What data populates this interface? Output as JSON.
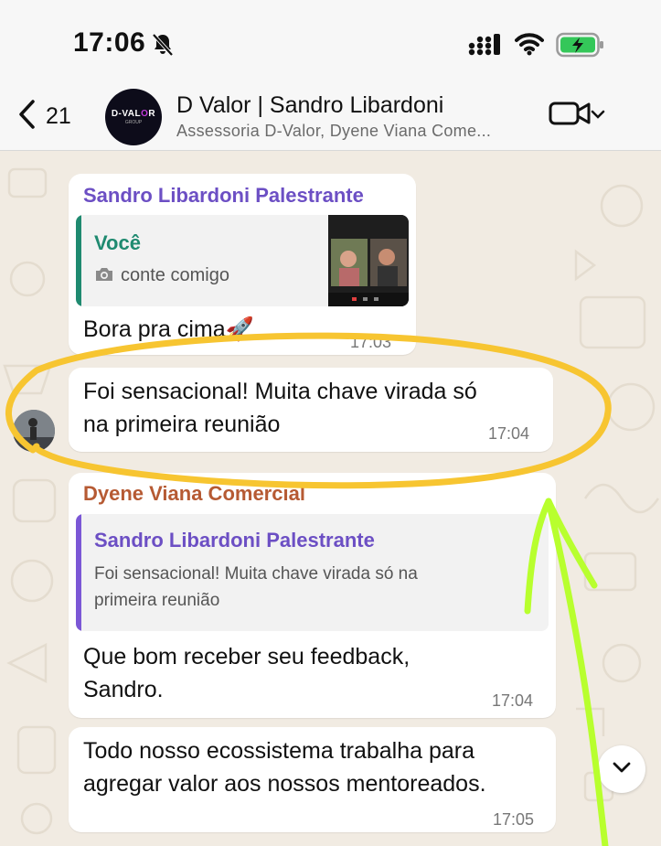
{
  "status_bar": {
    "time": "17:06",
    "icons": [
      "bell-slash-icon",
      "signal-icon",
      "wifi-icon",
      "battery-charging-icon"
    ]
  },
  "header": {
    "back_count": "21",
    "avatar_logo": "D-VAL",
    "avatar_logo_accent": "O",
    "avatar_logo_end": "R",
    "avatar_sub": "GROUP",
    "title": "D Valor | Sandro Libardoni",
    "subtitle": "Assessoria D-Valor, Dyene Viana Come..."
  },
  "messages": [
    {
      "sender": "Sandro Libardoni Palestrante",
      "quote_author": "Você",
      "quote_media_label": "conte comigo",
      "text": "Bora pra cima🚀",
      "time": "17:03"
    },
    {
      "text_line1": "Foi sensacional! Muita chave virada só",
      "text_line2": "na primeira reunião",
      "time": "17:04"
    },
    {
      "sender": "Dyene Viana Comercial",
      "quote_author": "Sandro Libardoni Palestrante",
      "quote_line1": "Foi sensacional! Muita chave virada só na",
      "quote_line2": "primeira reunião",
      "text_line1": "Que bom receber seu feedback,",
      "text_line2": "Sandro.",
      "time": "17:04"
    },
    {
      "text_line1": "Todo nosso ecossistema trabalha para",
      "text_line2": "agregar valor aos nossos mentoreados.",
      "time": "17:05"
    }
  ],
  "colors": {
    "sandro_name": "#6c4fc4",
    "dyene_name": "#b65a33",
    "quote_you": "#1f8a70",
    "quote_bar_sandro": "#7b57d6",
    "highlight_yellow": "#f7c531",
    "arrow_green": "#b8ff2e"
  }
}
